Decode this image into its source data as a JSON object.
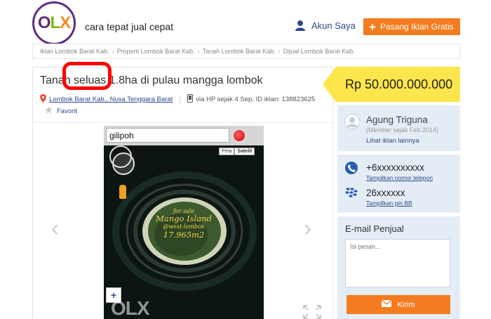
{
  "header": {
    "logo_text": "OLX",
    "tagline": "cara tepat jual cepat",
    "account_label": "Akun Saya",
    "post_ad_label": "Pasang Iklan Gratis",
    "colors": {
      "brand_purple": "#5c2d84",
      "brand_green": "#7fb800",
      "brand_orange": "#f68b1f",
      "button_orange": "#f47b20"
    }
  },
  "breadcrumb": [
    "Iklan Lombok Barat Kab.",
    "Properti Lombok Barat Kab.",
    "Tanah Lombok Barat Kab.",
    "Dijual Lombok Barat Kab."
  ],
  "ad": {
    "title": "Tanah seluas 1.8ha di pulau mangga lombok",
    "location": "Lombok Barat Kab., Nusa Tenggara Barat",
    "meta": "via HP sejak 4 Sep, ID iklan: 138823625",
    "favorite_label": "Favorit"
  },
  "photo": {
    "search_text": "gilipoh",
    "map_tabs": [
      "Peta",
      "Satelit"
    ],
    "zoom_in": "+",
    "watermark": "OLX",
    "overlay_line1": "for sale",
    "overlay_line2": "Mango Island",
    "overlay_line3": "@west-lombok",
    "overlay_line4": "17.965m2"
  },
  "price": {
    "label": "Rp 50.000.000.000",
    "color": "#fde64b"
  },
  "seller": {
    "name": "Agung Triguna",
    "member_since": "(Member sejak Feb 2014)",
    "other_ads_link": "Lihat iklan lainnya"
  },
  "contact": {
    "phone": "+6xxxxxxxxxx",
    "show_phone": "Tampilkan nomor telepon",
    "pin": "26xxxxxx",
    "show_pin": "Tampilkan pin BB"
  },
  "email": {
    "title": "E-mail Penjual",
    "placeholder": "Isi pesan...",
    "send_label": "Kirim"
  },
  "icons": [
    "user-icon",
    "plus-icon",
    "location-pin-icon",
    "phone-device-icon",
    "star-icon",
    "arrow-left-icon",
    "arrow-right-icon",
    "expand-icon",
    "phone-icon",
    "blackberry-icon",
    "mail-icon"
  ]
}
